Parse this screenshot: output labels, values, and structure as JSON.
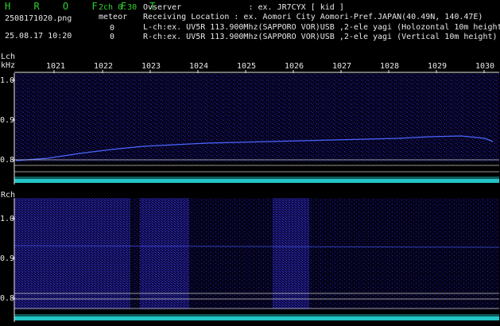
{
  "header": {
    "app_name": "H R O F F T",
    "mode": "2ch 0.30",
    "detection_label": "meteor",
    "filename": "2508171020.png",
    "datetime": "25.08.17 10:20",
    "count_l": "0",
    "count_r": "0",
    "observer": "Ovserver              : ex. JR7CYX [ kid ]",
    "location": "Receiving Location : ex. Aomori City Aomori-Pref.JAPAN(40.49N, 140.47E)",
    "lch_info": "L-ch:ex. UV5R 113.900Mhz(SAPPORO VOR)USB ,2-ele yagi (Holozontal 10m height)",
    "rch_info": "R-ch:ex. UV5R 113.900Mhz(SAPPORO VOR)USB ,2-ele yagi (Vertical 10m height)"
  },
  "time_ticks": [
    "1021",
    "1022",
    "1023",
    "1024",
    "1025",
    "1026",
    "1027",
    "1028",
    "1029",
    "1030"
  ],
  "lch": {
    "label": "Lch",
    "unit": "kHz",
    "y_ticks": [
      "1.0",
      "0.9",
      "0.8"
    ]
  },
  "rch": {
    "label": "Rch",
    "y_ticks": [
      "1.0",
      "0.9",
      "0.8"
    ]
  },
  "colors": {
    "background": "#000000",
    "noise_l": "#1e1a8a",
    "noise_r": "#1a1870",
    "signal": "#4a66ff",
    "level_bar": "#27e6e6",
    "header_green": "#2fd12f"
  }
}
